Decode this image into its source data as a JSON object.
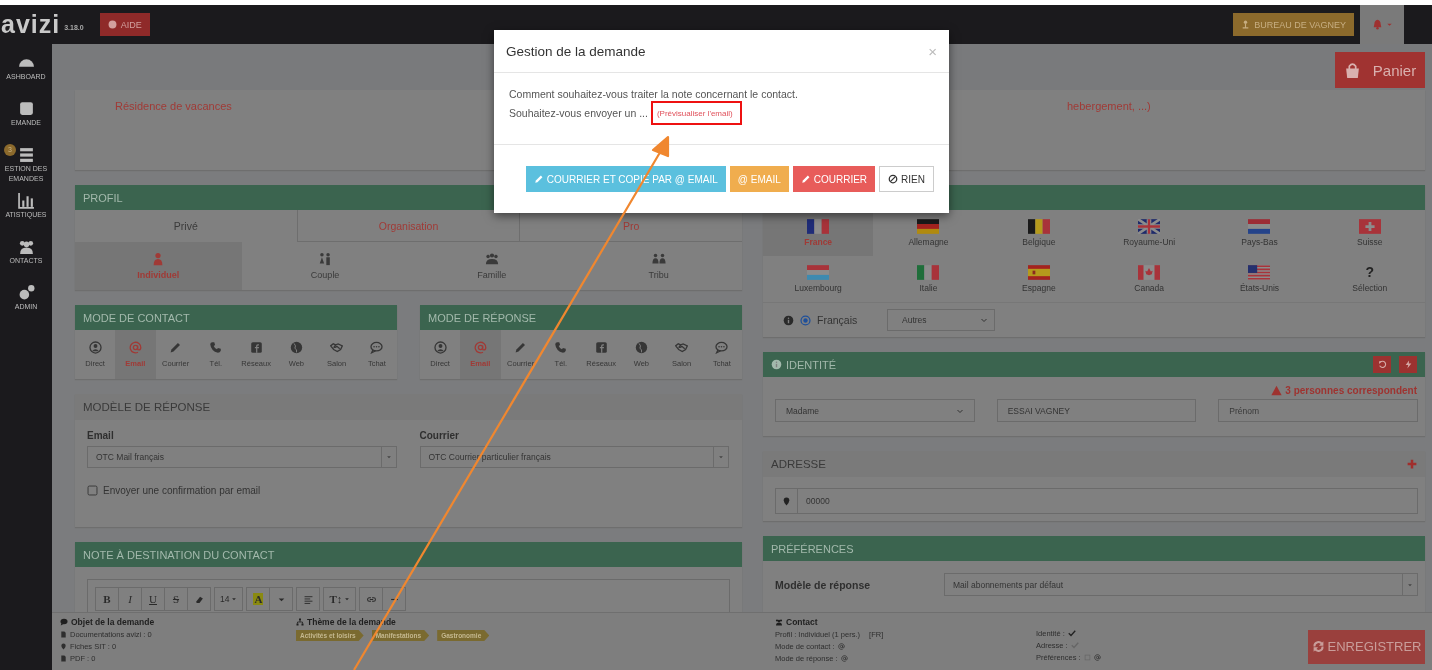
{
  "top_bar": {
    "logo": "avizi",
    "version": "3.18.0",
    "help_button": "AIDE",
    "office_button": "BUREAU DE VAGNEY"
  },
  "sidebar": {
    "items": [
      {
        "label": "ASHBOARD"
      },
      {
        "label": "EMANDE"
      },
      {
        "label": "ESTION DES EMANDES",
        "badge": "3"
      },
      {
        "label": "ATISTIQUES"
      },
      {
        "label": "ONTACTS"
      },
      {
        "label": "ADMIN"
      }
    ]
  },
  "cart_button": "Panier",
  "request_summary": "Résidence de vacances",
  "lodging_note": "hebergement, ...)",
  "profile": {
    "title": "PROFIL",
    "tabs": [
      {
        "label": "Privé",
        "selected": true
      },
      {
        "label": "Organisation",
        "selected": false
      },
      {
        "label": "Pro",
        "selected": false
      }
    ],
    "types": [
      {
        "label": "Individuel",
        "selected": true
      },
      {
        "label": "Couple",
        "selected": false
      },
      {
        "label": "Famille",
        "selected": false
      },
      {
        "label": "Tribu",
        "selected": false
      }
    ]
  },
  "contact_mode": {
    "title": "MODE DE CONTACT",
    "modes": [
      {
        "label": "Direct",
        "selected": false
      },
      {
        "label": "Email",
        "selected": true
      },
      {
        "label": "Courrier",
        "selected": false
      },
      {
        "label": "Tél.",
        "selected": false
      },
      {
        "label": "Réseaux",
        "selected": false
      },
      {
        "label": "Web",
        "selected": false
      },
      {
        "label": "Salon",
        "selected": false
      },
      {
        "label": "Tchat",
        "selected": false
      }
    ]
  },
  "response_mode": {
    "title": "MODE DE RÉPONSE",
    "modes": [
      {
        "label": "Direct",
        "selected": false
      },
      {
        "label": "Email",
        "selected": true
      },
      {
        "label": "Courrier",
        "selected": false
      },
      {
        "label": "Tél.",
        "selected": false
      },
      {
        "label": "Réseaux",
        "selected": false
      },
      {
        "label": "Web",
        "selected": false
      },
      {
        "label": "Salon",
        "selected": false
      },
      {
        "label": "Tchat",
        "selected": false
      }
    ]
  },
  "response_template": {
    "title": "MODÈLE DE RÉPONSE",
    "email_label": "Email",
    "email_value": "OTC Mail français",
    "mail_label": "Courrier",
    "mail_value": "OTC Courrier particulier français",
    "confirmation": {
      "label": "Envoyer une confirmation par email",
      "checked": false
    }
  },
  "note": {
    "title": "NOTE À DESTINATION DU CONTACT",
    "toolbar": [
      {
        "tools": [
          {
            "kind": "bold",
            "label": "B"
          },
          {
            "kind": "italic",
            "label": "I"
          },
          {
            "kind": "underline",
            "label": "U"
          },
          {
            "kind": "strike",
            "label": "S"
          },
          {
            "kind": "eraser"
          }
        ]
      },
      {
        "tools": [
          {
            "kind": "size",
            "label": "14"
          }
        ]
      },
      {
        "tools": [
          {
            "kind": "highlight",
            "label": "A"
          },
          {
            "kind": "caret"
          }
        ]
      },
      {
        "tools": [
          {
            "kind": "align"
          }
        ]
      },
      {
        "tools": [
          {
            "kind": "height",
            "label": "T↕"
          }
        ]
      },
      {
        "tools": [
          {
            "kind": "link"
          },
          {
            "kind": "rule"
          }
        ]
      }
    ]
  },
  "countries": {
    "items": [
      {
        "name": "France",
        "selected": true
      },
      {
        "name": "Allemagne",
        "selected": false
      },
      {
        "name": "Belgique",
        "selected": false
      },
      {
        "name": "Royaume-Uni",
        "selected": false
      },
      {
        "name": "Pays-Bas",
        "selected": false
      },
      {
        "name": "Suisse",
        "selected": false
      },
      {
        "name": "Luxembourg",
        "selected": false
      },
      {
        "name": "Italie",
        "selected": false
      },
      {
        "name": "Espagne",
        "selected": false
      },
      {
        "name": "Canada",
        "selected": false
      },
      {
        "name": "États-Unis",
        "selected": false
      },
      {
        "name": "Sélection",
        "symbol": "?",
        "selected": false
      }
    ],
    "language": {
      "label": "Français",
      "selected": true
    },
    "other_language": "Autres"
  },
  "identity": {
    "title": "IDENTITÉ",
    "warning": "3 personnes correspondent",
    "civility": "Madame",
    "last_name": "ESSAI VAGNEY",
    "first_name_placeholder": "Prénom"
  },
  "address": {
    "title": "ADRESSE",
    "postcode": "00000"
  },
  "preferences": {
    "title": "PRÉFÉRENCES",
    "template_label": "Modèle de réponse",
    "template_value": "Mail abonnements par défaut"
  },
  "footer": {
    "object_title": "Objet de la demande",
    "object_lines": [
      "Documentations avizi : 0",
      "Fiches SIT : 0",
      "PDF : 0"
    ],
    "theme_title": "Thème de la demande",
    "theme_tags": [
      "Activités et loisirs",
      "Manifestations",
      "Gastronomie"
    ],
    "contact_title": "Contact",
    "profile_line": "Profil : Individuel (1 pers.)",
    "profile_lang": "[FR]",
    "contact_mode_label": "Mode de contact :",
    "response_mode_label": "Mode de réponse :",
    "checks": [
      {
        "label": "Identité :",
        "kind": "tick",
        "done": true
      },
      {
        "label": "Adresse :",
        "kind": "tick",
        "done": false
      },
      {
        "label": "Préférences :",
        "kind": "channels"
      }
    ],
    "save_button": "ENREGISTRER"
  },
  "modal": {
    "title": "Gestion de la demande",
    "close": "×",
    "lines": [
      "Comment souhaitez-vous traiter la note concernant le contact.",
      "Souhaitez-vous envoyer un ..."
    ],
    "preview_link": "(Prévisualiser l'email)",
    "buttons": [
      {
        "label": "COURRIER ET COPIE PAR @ EMAIL",
        "kind": "info"
      },
      {
        "label": "@ EMAIL",
        "kind": "warning"
      },
      {
        "label": "COURRIER",
        "kind": "danger"
      },
      {
        "label": "RIEN",
        "kind": "default"
      }
    ]
  }
}
